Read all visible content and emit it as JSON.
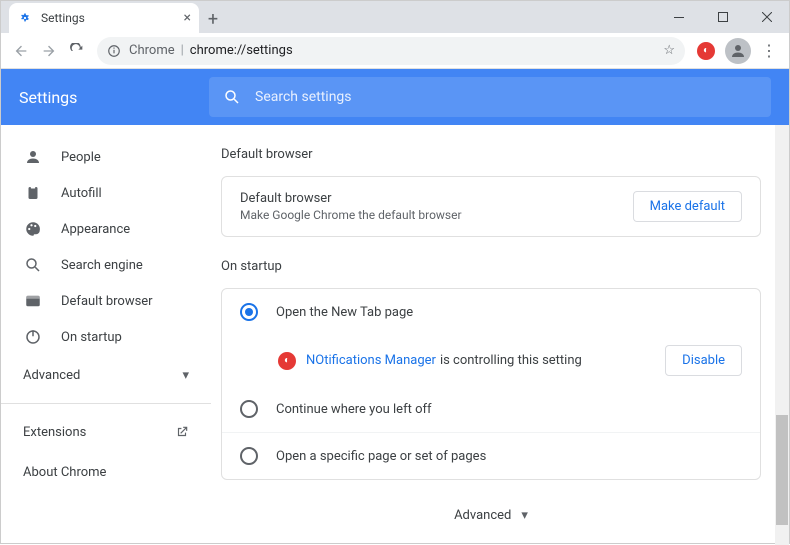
{
  "window": {
    "tab_title": "Settings"
  },
  "urlbar": {
    "chip": "Chrome",
    "url": "chrome://settings"
  },
  "header": {
    "title": "Settings",
    "search_placeholder": "Search settings"
  },
  "sidebar": {
    "items": [
      {
        "label": "People"
      },
      {
        "label": "Autofill"
      },
      {
        "label": "Appearance"
      },
      {
        "label": "Search engine"
      },
      {
        "label": "Default browser"
      },
      {
        "label": "On startup"
      }
    ],
    "advanced": "Advanced",
    "extensions": "Extensions",
    "about": "About Chrome"
  },
  "main": {
    "default_browser": {
      "section": "Default browser",
      "title": "Default browser",
      "subtitle": "Make Google Chrome the default browser",
      "button": "Make default"
    },
    "startup": {
      "section": "On startup",
      "options": [
        "Open the New Tab page",
        "Continue where you left off",
        "Open a specific page or set of pages"
      ],
      "ext_name": "NOtifications Manager",
      "ext_post": "is controlling this setting",
      "disable": "Disable"
    },
    "advanced_btn": "Advanced"
  }
}
